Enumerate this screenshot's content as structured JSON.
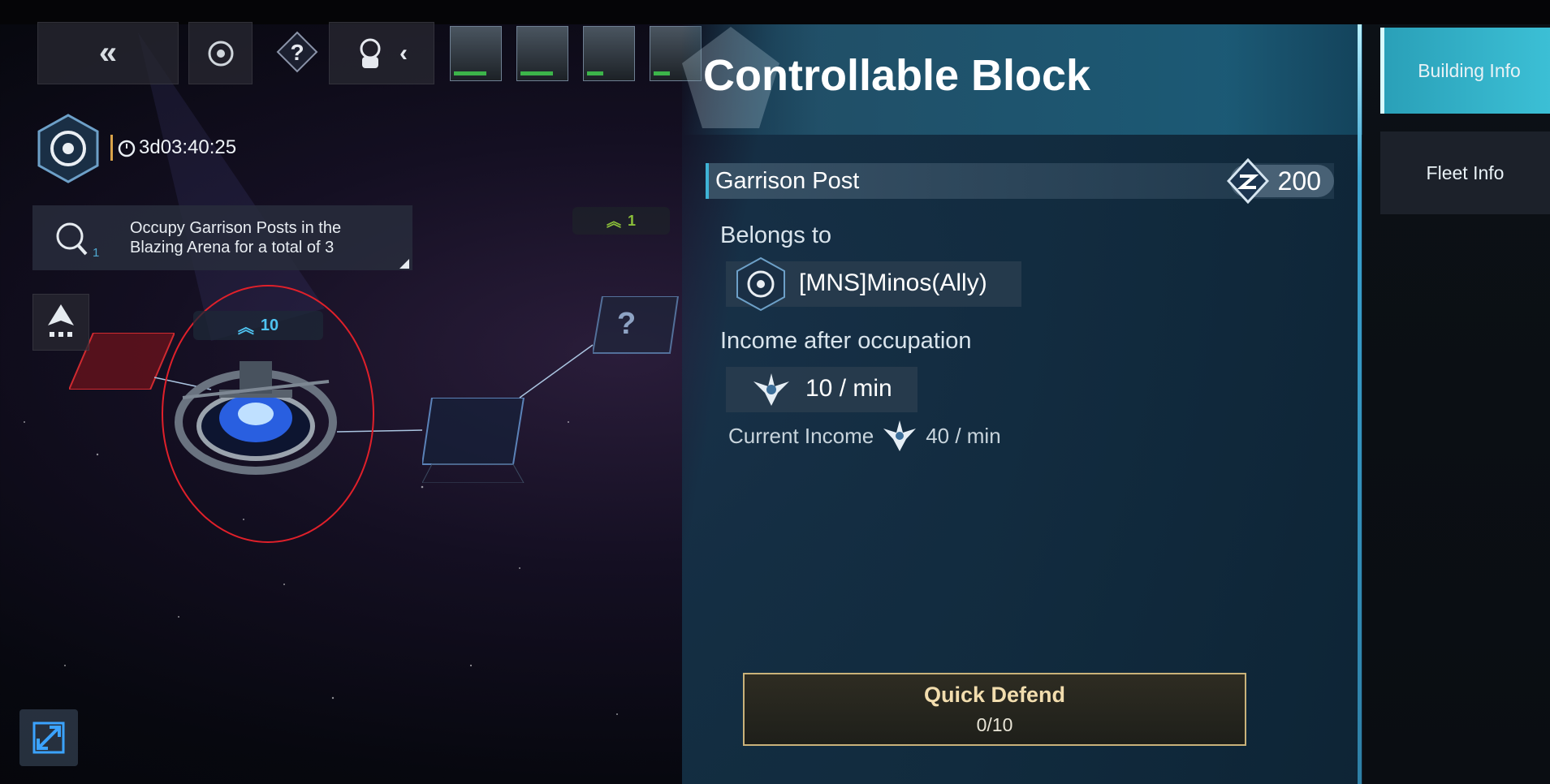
{
  "top_bar": {
    "back_icon": "double-chevron-left-icon",
    "target_icon": "target-icon",
    "help_icon": "question-icon",
    "team_icon": "astronaut-icon",
    "collapse_icon": "chevron-left-icon",
    "portraits": [
      "commander-1",
      "commander-2",
      "commander-3",
      "commander-4"
    ]
  },
  "alliance": {
    "timer": "3d03:40:25"
  },
  "quest": {
    "text": "Occupy Garrison Posts in the Blazing Arena for a total of 3",
    "count": "1"
  },
  "map": {
    "node_level_main": "10",
    "node_level_small": "1",
    "unknown_node_label": "?"
  },
  "panel": {
    "title": "Controllable Block",
    "building_name": "Garrison Post",
    "building_value": "200",
    "belongs_label": "Belongs to",
    "owner": "[MNS]Minos(Ally)",
    "income_label": "Income after occupation",
    "income_value": "10 / min",
    "current_income_label": "Current Income",
    "current_income_value": "40 / min",
    "quick_defend_label": "Quick Defend",
    "quick_defend_count": "0/10"
  },
  "tabs": {
    "building_info": "Building Info",
    "fleet_info": "Fleet Info"
  },
  "colors": {
    "accent_cyan": "#3fb3d6",
    "panel_bg": "#173a52",
    "quick_border": "#c9b27a",
    "highlight_red": "#e0202a"
  }
}
